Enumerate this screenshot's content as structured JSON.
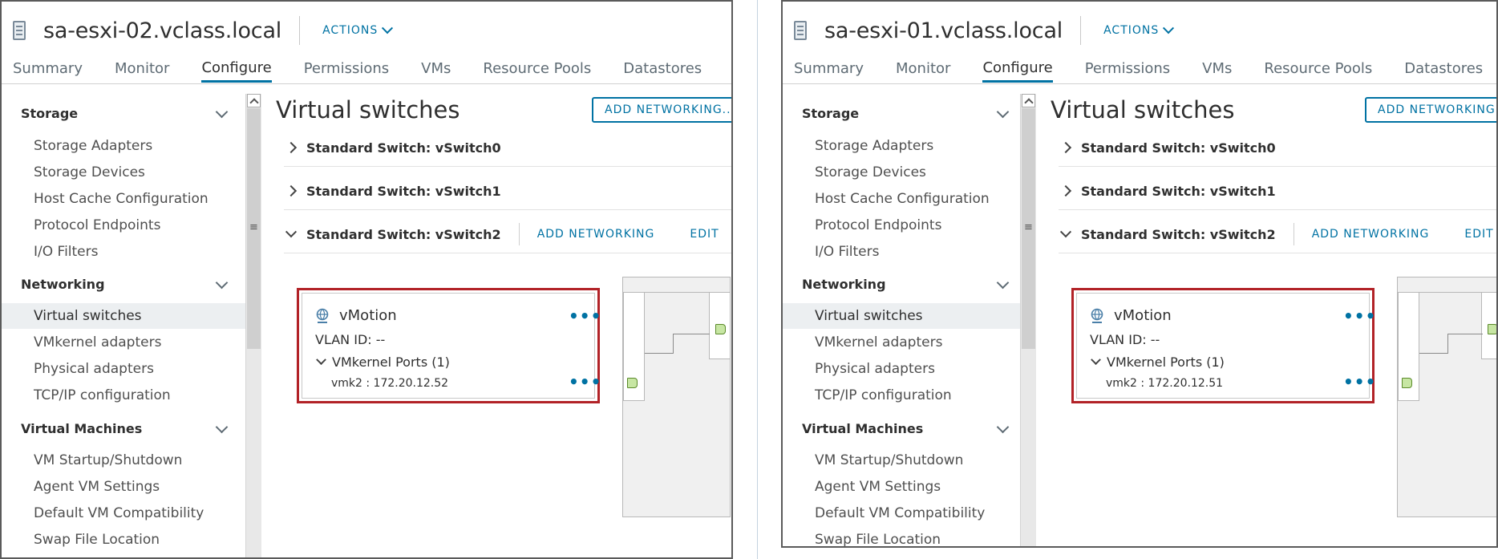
{
  "left": {
    "host_name": "sa-esxi-02.vclass.local",
    "actions_label": "ACTIONS",
    "tabs": [
      "Summary",
      "Monitor",
      "Configure",
      "Permissions",
      "VMs",
      "Resource Pools",
      "Datastores"
    ],
    "active_tab": "Configure",
    "sidebar": {
      "storage_head": "Storage",
      "storage_items": [
        "Storage Adapters",
        "Storage Devices",
        "Host Cache Configuration",
        "Protocol Endpoints",
        "I/O Filters"
      ],
      "networking_head": "Networking",
      "networking_items": [
        "Virtual switches",
        "VMkernel adapters",
        "Physical adapters",
        "TCP/IP configuration"
      ],
      "vm_head": "Virtual Machines",
      "vm_items": [
        "VM Startup/Shutdown",
        "Agent VM Settings",
        "Default VM Compatibility",
        "Swap File Location"
      ]
    },
    "content_title": "Virtual switches",
    "add_networking_btn": "ADD NETWORKING...",
    "switches": [
      "Standard Switch: vSwitch0",
      "Standard Switch: vSwitch1",
      "Standard Switch: vSwitch2"
    ],
    "add_networking_link": "ADD NETWORKING",
    "edit_link": "EDIT",
    "portgroup": {
      "name": "vMotion",
      "vlan": "VLAN ID: --",
      "ports": "VMkernel Ports (1)",
      "vmk": "vmk2 : 172.20.12.52",
      "more": "•••"
    }
  },
  "right": {
    "host_name": "sa-esxi-01.vclass.local",
    "actions_label": "ACTIONS",
    "tabs": [
      "Summary",
      "Monitor",
      "Configure",
      "Permissions",
      "VMs",
      "Resource Pools",
      "Datastores"
    ],
    "active_tab": "Configure",
    "sidebar": {
      "storage_head": "Storage",
      "storage_items": [
        "Storage Adapters",
        "Storage Devices",
        "Host Cache Configuration",
        "Protocol Endpoints",
        "I/O Filters"
      ],
      "networking_head": "Networking",
      "networking_items": [
        "Virtual switches",
        "VMkernel adapters",
        "Physical adapters",
        "TCP/IP configuration"
      ],
      "vm_head": "Virtual Machines",
      "vm_items": [
        "VM Startup/Shutdown",
        "Agent VM Settings",
        "Default VM Compatibility",
        "Swap File Location"
      ]
    },
    "content_title": "Virtual switches",
    "add_networking_btn": "ADD NETWORKING...",
    "switches": [
      "Standard Switch: vSwitch0",
      "Standard Switch: vSwitch1",
      "Standard Switch: vSwitch2"
    ],
    "add_networking_link": "ADD NETWORKING",
    "edit_link": "EDIT",
    "portgroup": {
      "name": "vMotion",
      "vlan": "VLAN ID: --",
      "ports": "VMkernel Ports (1)",
      "vmk": "vmk2 : 172.20.12.51",
      "more": "•••"
    }
  },
  "colors": {
    "accent": "#0072a3",
    "highlight_box": "#b22227",
    "port_green": "#c7e6a3"
  }
}
